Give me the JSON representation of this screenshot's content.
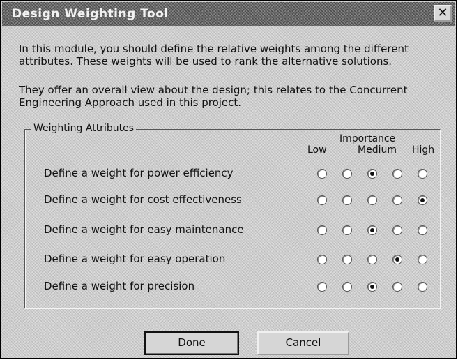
{
  "window": {
    "title": "Design Weighting Tool",
    "close_glyph": "✕"
  },
  "intro": {
    "paragraph1": "In this module, you should define the relative weights among the different attributes. These weights will be used to rank the alternative solutions.",
    "paragraph2": "They offer an overall view about the design; this relates to the Concurrent Engineering Approach used in this project."
  },
  "group": {
    "legend": "Weighting Attributes",
    "scale_title": "Importance",
    "scale_low": "Low",
    "scale_medium": "Medium",
    "scale_high": "High"
  },
  "rows": [
    {
      "label": "Define a weight for power efficiency",
      "selected": 3
    },
    {
      "label": "Define a weight for cost effectiveness",
      "selected": 5
    },
    {
      "label": "Define a weight for easy maintenance",
      "selected": 3
    },
    {
      "label": "Define a weight for easy operation",
      "selected": 4
    },
    {
      "label": "Define a weight for precision",
      "selected": 3
    }
  ],
  "buttons": {
    "done": "Done",
    "cancel": "Cancel"
  }
}
